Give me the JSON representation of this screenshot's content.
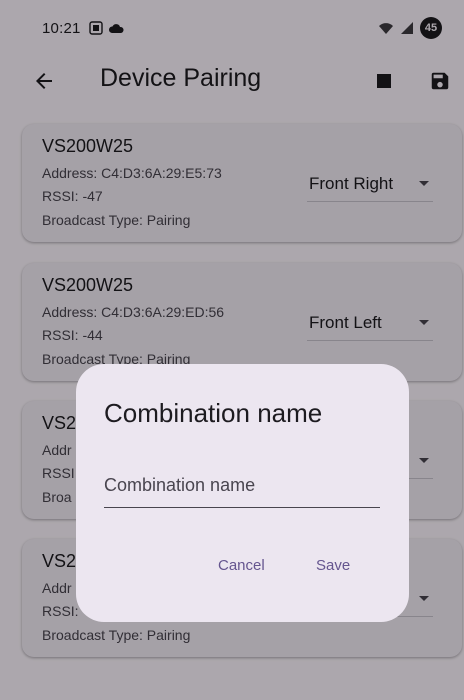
{
  "status_bar": {
    "time": "10:21",
    "battery": "45",
    "left_icons": [
      "screenshot-icon",
      "cloud-icon"
    ],
    "right_icons": [
      "wifi-icon",
      "signal-icon"
    ]
  },
  "app_bar": {
    "title": "Device Pairing",
    "back_icon": "arrow-back-icon",
    "stop_icon": "stop-icon",
    "save_icon": "save-icon"
  },
  "devices": [
    {
      "name": "VS200W25",
      "address": "Address: C4:D3:6A:29:E5:73",
      "rssi": "RSSI: -47",
      "broadcast": "Broadcast Type: Pairing",
      "position": "Front Right"
    },
    {
      "name": "VS200W25",
      "address": "Address: C4:D3:6A:29:ED:56",
      "rssi": "RSSI: -44",
      "broadcast": "Broadcast Type: Pairing",
      "position": "Front Left"
    },
    {
      "name": "VS2",
      "address": "Addr",
      "rssi": "RSSI",
      "broadcast": "Broa",
      "position": ""
    },
    {
      "name": "VS2",
      "address": "Addr",
      "rssi": "RSSI:",
      "broadcast": "Broadcast Type: Pairing",
      "position": ""
    }
  ],
  "dialog": {
    "title": "Combination name",
    "field_placeholder": "Combination name",
    "field_value": "",
    "cancel_label": "Cancel",
    "save_label": "Save"
  },
  "colors": {
    "background": "#fef7ff",
    "card": "#f3edf7",
    "dialog": "#ece6f0",
    "accent": "#65558f"
  }
}
